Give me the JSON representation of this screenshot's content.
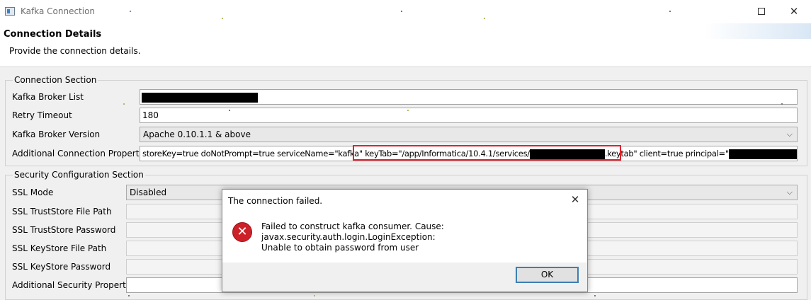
{
  "window": {
    "title": "Kafka Connection",
    "minimize_glyph": "—",
    "close_glyph": "✕"
  },
  "header": {
    "title": "Connection Details",
    "description": "Provide the connection details."
  },
  "connection_section": {
    "legend": "Connection Section",
    "broker_list_label": "Kafka Broker List",
    "retry_timeout_label": "Retry Timeout",
    "retry_timeout_value": "180",
    "broker_version_label": "Kafka Broker Version",
    "broker_version_value": "Apache 0.10.1.1 & above",
    "additional_props_label": "Additional Connection Properties",
    "additional_props_part1": "storeKey=true doNotPrompt=true serviceName=\"kafka\"",
    "additional_props_part2": "keyTab=\"/app/Informatica/10.4.1/services/",
    "additional_props_part3": ".keytab\"",
    "additional_props_part4": "client=true principal=\"",
    "additional_props_part5": "\";"
  },
  "security_section": {
    "legend": "Security Configuration Section",
    "ssl_mode_label": "SSL Mode",
    "ssl_mode_value": "Disabled",
    "truststore_path_label": "SSL TrustStore File Path",
    "truststore_password_label": "SSL TrustStore Password",
    "keystore_path_label": "SSL KeyStore File Path",
    "keystore_password_label": "SSL KeyStore Password",
    "additional_security_label": "Additional Security Properties"
  },
  "dialog": {
    "title": "The connection failed.",
    "close_glyph": "✕",
    "message_line1": "Failed to construct kafka consumer. Cause: javax.security.auth.login.LoginException:",
    "message_line2": "Unable to obtain password from user",
    "ok_label": "OK",
    "error_glyph": "✕"
  },
  "colors": {
    "highlight": "#e0222a",
    "error_icon": "#cc2128",
    "ok_border": "#3c7fb1"
  }
}
